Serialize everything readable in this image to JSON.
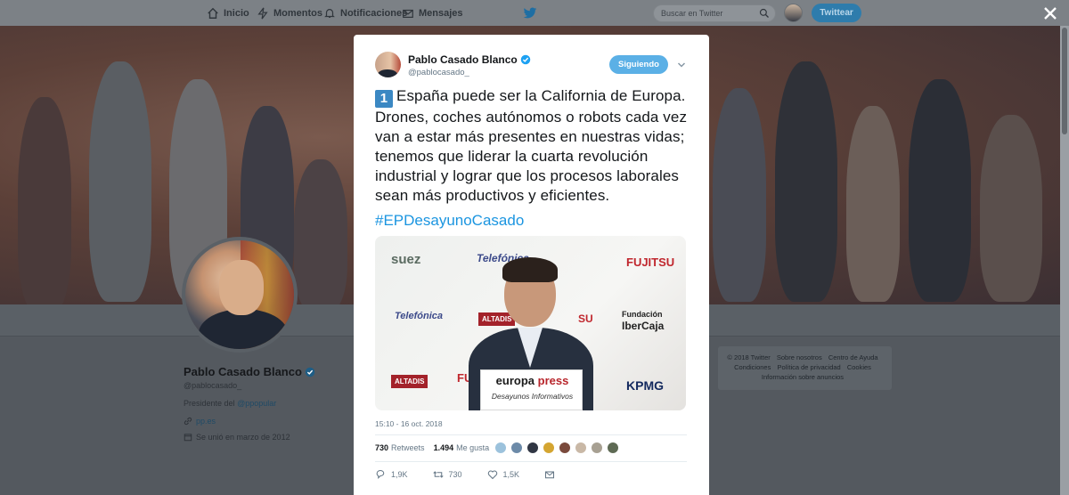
{
  "nav": {
    "items": [
      {
        "label": "Inicio",
        "icon": "home-icon"
      },
      {
        "label": "Momentos",
        "icon": "lightning-icon"
      },
      {
        "label": "Notificaciones",
        "icon": "bell-icon"
      },
      {
        "label": "Mensajes",
        "icon": "envelope-icon"
      }
    ],
    "search_placeholder": "Buscar en Twitter",
    "tweet_button": "Twittear"
  },
  "profile": {
    "name": "Pablo Casado Blanco",
    "handle": "@pablocasado_",
    "bio_prefix": "Presidente del",
    "bio_mention": "@ppopular",
    "link": "pp.es",
    "joined": "Se unió en marzo de 2012"
  },
  "footer": {
    "items": [
      "© 2018 Twitter",
      "Sobre nosotros",
      "Centro de Ayuda",
      "Condiciones",
      "Política de privacidad",
      "Cookies",
      "Información sobre anuncios"
    ]
  },
  "tweet": {
    "author_name": "Pablo Casado Blanco",
    "author_handle": "@pablocasado_",
    "follow_label": "Siguiendo",
    "number_emoji": "1",
    "text": "España puede ser la California de Europa. Drones, coches autónomos o robots cada vez van a estar más presentes en nuestras vidas; tenemos que liderar la cuarta revolución industrial y lograr que los procesos laborales sean más productivos y eficientes.",
    "hashtag": "#EPDesayunoCasado",
    "timestamp": "15:10 - 16 oct. 2018",
    "retweets_count": "730",
    "retweets_label": "Retweets",
    "likes_count": "1.494",
    "likes_label": "Me gusta",
    "reply_count": "1,9K",
    "retweet_action_count": "730",
    "like_action_count": "1,5K",
    "media": {
      "sponsors": [
        "suez",
        "Telefónica",
        "FUJITSU",
        "Telefónica",
        "ALTADIS",
        "Fundación",
        "IberCaja",
        "ALTADIS",
        "FU",
        "KPMG",
        "SU"
      ],
      "podium_brand_1": "europa",
      "podium_brand_2": "press",
      "podium_sub": "Desayunos Informativos"
    }
  },
  "colors": {
    "accent": "#1b95e0",
    "follow_button": "#5bb0e6",
    "overlay": "#565c63"
  }
}
